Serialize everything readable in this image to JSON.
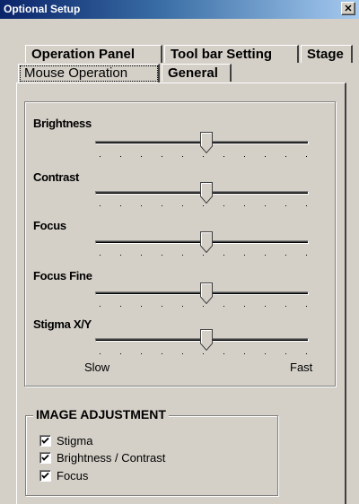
{
  "window": {
    "title": "Optional Setup",
    "close_label": "✕"
  },
  "tabs_row1": [
    {
      "label": "Operation Panel"
    },
    {
      "label": "Tool bar Setting"
    },
    {
      "label": "Stage"
    }
  ],
  "tabs_row2": [
    {
      "label": "Mouse Operation",
      "selected": true
    },
    {
      "label": "General"
    }
  ],
  "sliders": [
    {
      "label": "Brightness",
      "value": 0.52
    },
    {
      "label": "Contrast",
      "value": 0.52
    },
    {
      "label": "Focus",
      "value": 0.52
    },
    {
      "label": "Focus Fine",
      "value": 0.52
    },
    {
      "label": "Stigma X/Y",
      "value": 0.52
    }
  ],
  "scale": {
    "min_label": "Slow",
    "max_label": "Fast"
  },
  "image_adjustment": {
    "title": "IMAGE ADJUSTMENT",
    "options": [
      {
        "label": "Stigma",
        "checked": true
      },
      {
        "label": "Brightness / Contrast",
        "checked": true
      },
      {
        "label": "Focus",
        "checked": true
      }
    ]
  }
}
